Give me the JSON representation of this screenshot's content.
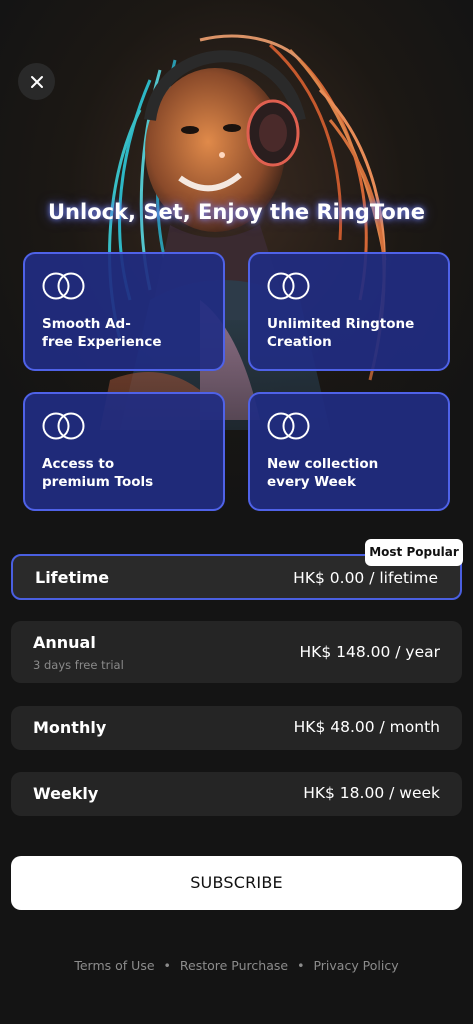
{
  "header": {
    "headline": "Unlock, Set, Enjoy the RingTone"
  },
  "features": [
    {
      "label": "Smooth Ad-\nfree Experience",
      "icon": "overlapping-circles-icon"
    },
    {
      "label": "Unlimited Ringtone\nCreation",
      "icon": "overlapping-circles-icon"
    },
    {
      "label": "Access to\npremium Tools",
      "icon": "overlapping-circles-icon"
    },
    {
      "label": "New collection\nevery Week",
      "icon": "overlapping-circles-icon"
    }
  ],
  "plans": [
    {
      "name": "Lifetime",
      "price": "HK$ 0.00 / lifetime",
      "badge": "Most Popular",
      "selected": true
    },
    {
      "name": "Annual",
      "price": "HK$ 148.00 / year",
      "subtitle": "3 days free trial"
    },
    {
      "name": "Monthly",
      "price": "HK$ 48.00 / month"
    },
    {
      "name": "Weekly",
      "price": "HK$ 18.00 / week"
    }
  ],
  "actions": {
    "subscribe_label": "SUBSCRIBE"
  },
  "footer": {
    "terms": "Terms of Use",
    "restore": "Restore Purchase",
    "privacy": "Privacy Policy",
    "separator": "•"
  },
  "colors": {
    "background": "#141414",
    "card_fill": "#212c82",
    "card_border": "#4f62e8",
    "plan_fill": "#252525",
    "selected_border": "#4a5fe0"
  }
}
